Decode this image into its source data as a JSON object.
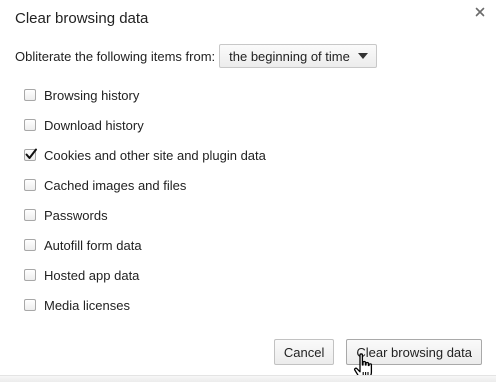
{
  "dialog": {
    "title": "Clear browsing data",
    "close_icon": "close-icon"
  },
  "range": {
    "label": "Obliterate the following items from:",
    "selected": "the beginning of time"
  },
  "options": [
    {
      "label": "Browsing history",
      "checked": false
    },
    {
      "label": "Download history",
      "checked": false
    },
    {
      "label": "Cookies and other site and plugin data",
      "checked": true
    },
    {
      "label": "Cached images and files",
      "checked": false
    },
    {
      "label": "Passwords",
      "checked": false
    },
    {
      "label": "Autofill form data",
      "checked": false
    },
    {
      "label": "Hosted app data",
      "checked": false
    },
    {
      "label": "Media licenses",
      "checked": false
    }
  ],
  "buttons": {
    "cancel_label": "Cancel",
    "clear_label": "Clear browsing data"
  },
  "cursor_icon": "hand-pointer-icon"
}
